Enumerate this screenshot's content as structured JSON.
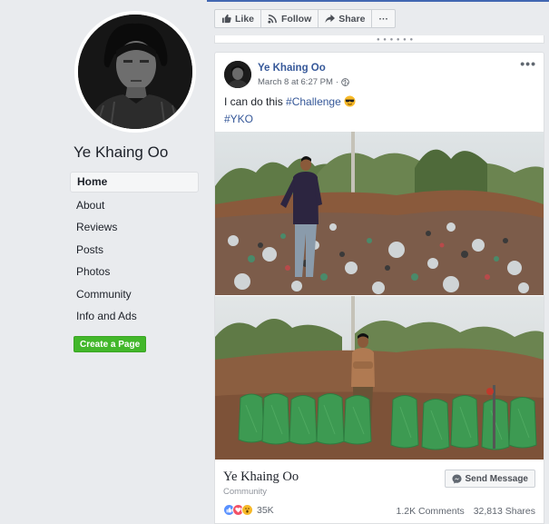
{
  "sidebar": {
    "page_name": "Ye Khaing Oo",
    "nav": [
      {
        "label": "Home",
        "active": true
      },
      {
        "label": "About"
      },
      {
        "label": "Reviews"
      },
      {
        "label": "Posts"
      },
      {
        "label": "Photos"
      },
      {
        "label": "Community"
      },
      {
        "label": "Info and Ads"
      }
    ],
    "create_page_label": "Create a Page"
  },
  "action_bar": {
    "like_label": "Like",
    "follow_label": "Follow",
    "share_label": "Share",
    "more_label": "···"
  },
  "post": {
    "author": "Ye Khaing Oo",
    "timestamp": "March 8 at 6:27 PM",
    "separator": "·",
    "privacy_icon": "globe-icon",
    "text_prefix": "I can do this ",
    "hashtag": "#Challenge",
    "emoji": "sunglasses-emoji",
    "tag": "#YKO",
    "more_label": "•••",
    "photos": [
      {
        "description": "man standing in field of trash (before)"
      },
      {
        "description": "man standing behind filled green bags (after)"
      }
    ],
    "link_preview": {
      "title": "Ye Khaing Oo",
      "subtitle": "Community",
      "send_message_label": "Send Message"
    },
    "reactions": {
      "icons": [
        "like",
        "love",
        "wow"
      ],
      "count": "35K"
    },
    "comments": "1.2K Comments",
    "shares": "32,813 Shares"
  },
  "colors": {
    "link": "#365899",
    "fb_blue": "#4267b2",
    "create_green": "#42b72a",
    "bag_green": "#3d9a52"
  }
}
